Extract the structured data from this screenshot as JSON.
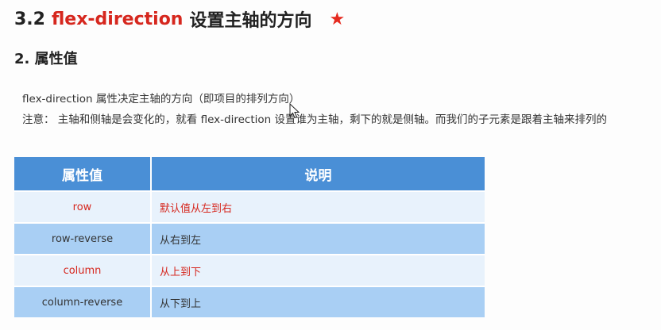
{
  "heading": {
    "number": "3.2",
    "keyword": "flex-direction",
    "text": "设置主轴的方向",
    "star": "★"
  },
  "subheading": "2. 属性值",
  "paragraphs": [
    "flex-direction 属性决定主轴的方向（即项目的排列方向）",
    "注意： 主轴和侧轴是会变化的，就看 flex-direction 设置谁为主轴，剩下的就是侧轴。而我们的子元素是跟着主轴来排列的"
  ],
  "table": {
    "headers": [
      "属性值",
      "说明"
    ],
    "rows": [
      {
        "value": "row",
        "desc": "默认值从左到右",
        "highlight": true
      },
      {
        "value": "row-reverse",
        "desc": "从右到左",
        "highlight": false
      },
      {
        "value": "column",
        "desc": "从上到下",
        "highlight": true
      },
      {
        "value": "column-reverse",
        "desc": "从下到上",
        "highlight": false
      }
    ]
  },
  "colors": {
    "accent_red": "#d6271e",
    "header_blue": "#4a8fd6",
    "row_light": "#e8f2fc",
    "row_dark": "#a9cff4"
  }
}
